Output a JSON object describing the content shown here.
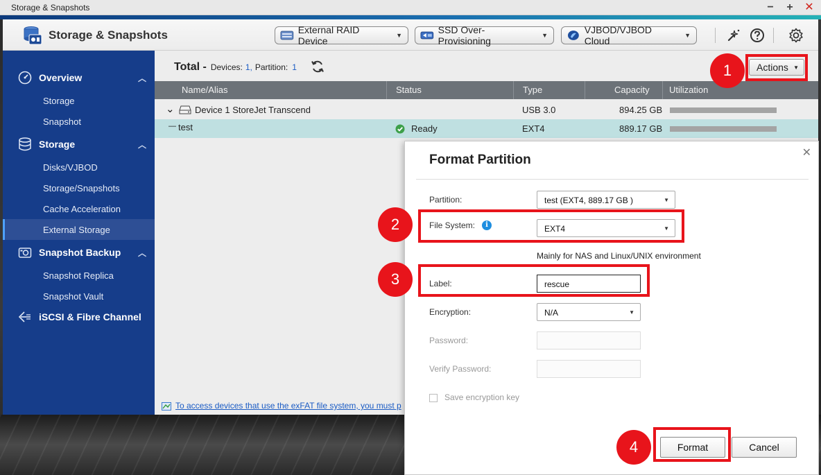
{
  "window": {
    "title": "Storage & Snapshots",
    "controls": {
      "minimize": "−",
      "maximize": "+",
      "close": "✕"
    }
  },
  "header": {
    "app_title": "Storage & Snapshots",
    "buttons": [
      {
        "label": "External RAID Device",
        "icon": "raid-device-icon"
      },
      {
        "label": "SSD Over-Provisioning",
        "icon": "ssd-icon"
      },
      {
        "label": "VJBOD/VJBOD Cloud",
        "icon": "vjbod-cloud-icon"
      }
    ],
    "icons": [
      "tools-icon",
      "help-icon",
      "settings-icon"
    ]
  },
  "sidebar": {
    "groups": [
      {
        "label": "Overview",
        "icon": "gauge-icon",
        "items": [
          "Storage",
          "Snapshot"
        ]
      },
      {
        "label": "Storage",
        "icon": "database-icon",
        "items": [
          "Disks/VJBOD",
          "Storage/Snapshots",
          "Cache Acceleration",
          "External Storage"
        ]
      },
      {
        "label": "Snapshot Backup",
        "icon": "camera-icon",
        "items": [
          "Snapshot Replica",
          "Snapshot Vault"
        ]
      },
      {
        "label": "iSCSI & Fibre Channel",
        "icon": "iscsi-icon",
        "items": []
      }
    ],
    "active_item": "External Storage"
  },
  "main": {
    "summary": {
      "total_label": "Total -",
      "devices_label": "Devices:",
      "devices_count": "1,",
      "partition_label": "Partition:",
      "partition_count": "1"
    },
    "actions_label": "Actions",
    "columns": [
      "Name/Alias",
      "Status",
      "Type",
      "Capacity",
      "Utilization"
    ],
    "rows": [
      {
        "name": "Device 1 StoreJet Transcend",
        "status": "",
        "type": "USB 3.0",
        "capacity": "894.25 GB"
      },
      {
        "name": "test",
        "prefix": "—",
        "status": "Ready",
        "type": "EXT4",
        "capacity": "889.17 GB"
      }
    ],
    "notice": "To access devices that use the exFAT file system, you must p"
  },
  "modal": {
    "title": "Format Partition",
    "close": "✕",
    "fields": {
      "partition": {
        "label": "Partition:",
        "value": "test (EXT4, 889.17 GB )"
      },
      "file_system": {
        "label": "File System:",
        "value": "EXT4",
        "hint": "Mainly for NAS and Linux/UNIX environment"
      },
      "label": {
        "label": "Label:",
        "value": "rescue"
      },
      "encryption": {
        "label": "Encryption:",
        "value": "N/A"
      },
      "password": {
        "label": "Password:",
        "value": ""
      },
      "verify_password": {
        "label": "Verify Password:",
        "value": ""
      },
      "save_key": {
        "label": "Save encryption key",
        "checked": false
      }
    },
    "format_label": "Format",
    "cancel_label": "Cancel"
  },
  "callouts": [
    "1",
    "2",
    "3",
    "4"
  ],
  "colors": {
    "sidebar": "#163d8a",
    "callout": "#e8141b",
    "selected_row": "#bfe0e1",
    "link": "#1a5bc4"
  }
}
